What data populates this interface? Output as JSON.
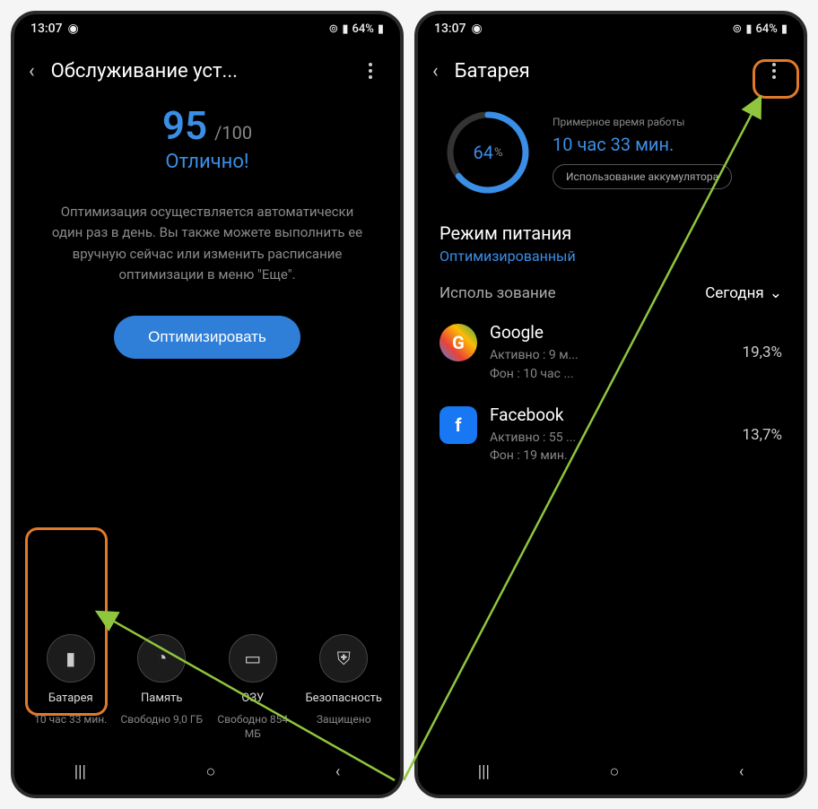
{
  "status": {
    "time": "13:07",
    "battery_text": "64%"
  },
  "left": {
    "title": "Обслуживание уст...",
    "score": "95",
    "score_max": "/100",
    "score_label": "Отлично!",
    "desc": "Оптимизация осуществляется автоматически один раз в день. Вы также можете выполнить ее вручную сейчас или изменить расписание оптимизации в меню \"Еще\".",
    "optimize": "Оптимизировать",
    "tiles": [
      {
        "name": "Батарея",
        "sub": "10 час 33 мин."
      },
      {
        "name": "Память",
        "sub": "Свободно 9,0 ГБ"
      },
      {
        "name": "ОЗУ",
        "sub": "Свободно 854 МБ"
      },
      {
        "name": "Безопасность",
        "sub": "Защищено"
      }
    ]
  },
  "right": {
    "title": "Батарея",
    "ring_value": "64",
    "ring_label": "Примерное время работы",
    "ring_time": "10 час 33 мин.",
    "usage_btn": "Использование аккумулятора",
    "mode_title": "Режим питания",
    "mode_value": "Оптимизированный",
    "usage_label": "Исполь зование",
    "usage_value": "Сегодня",
    "apps": [
      {
        "name": "Google",
        "active": "Активно : 9 м...",
        "bg": "Фон : 10 час ...",
        "pct": "19,3%"
      },
      {
        "name": "Facebook",
        "active": "Активно : 55 ...",
        "bg": "Фон : 19 мин.",
        "pct": "13,7%"
      }
    ]
  },
  "nav": {
    "recent": "|||",
    "home": "○",
    "back": "‹"
  }
}
